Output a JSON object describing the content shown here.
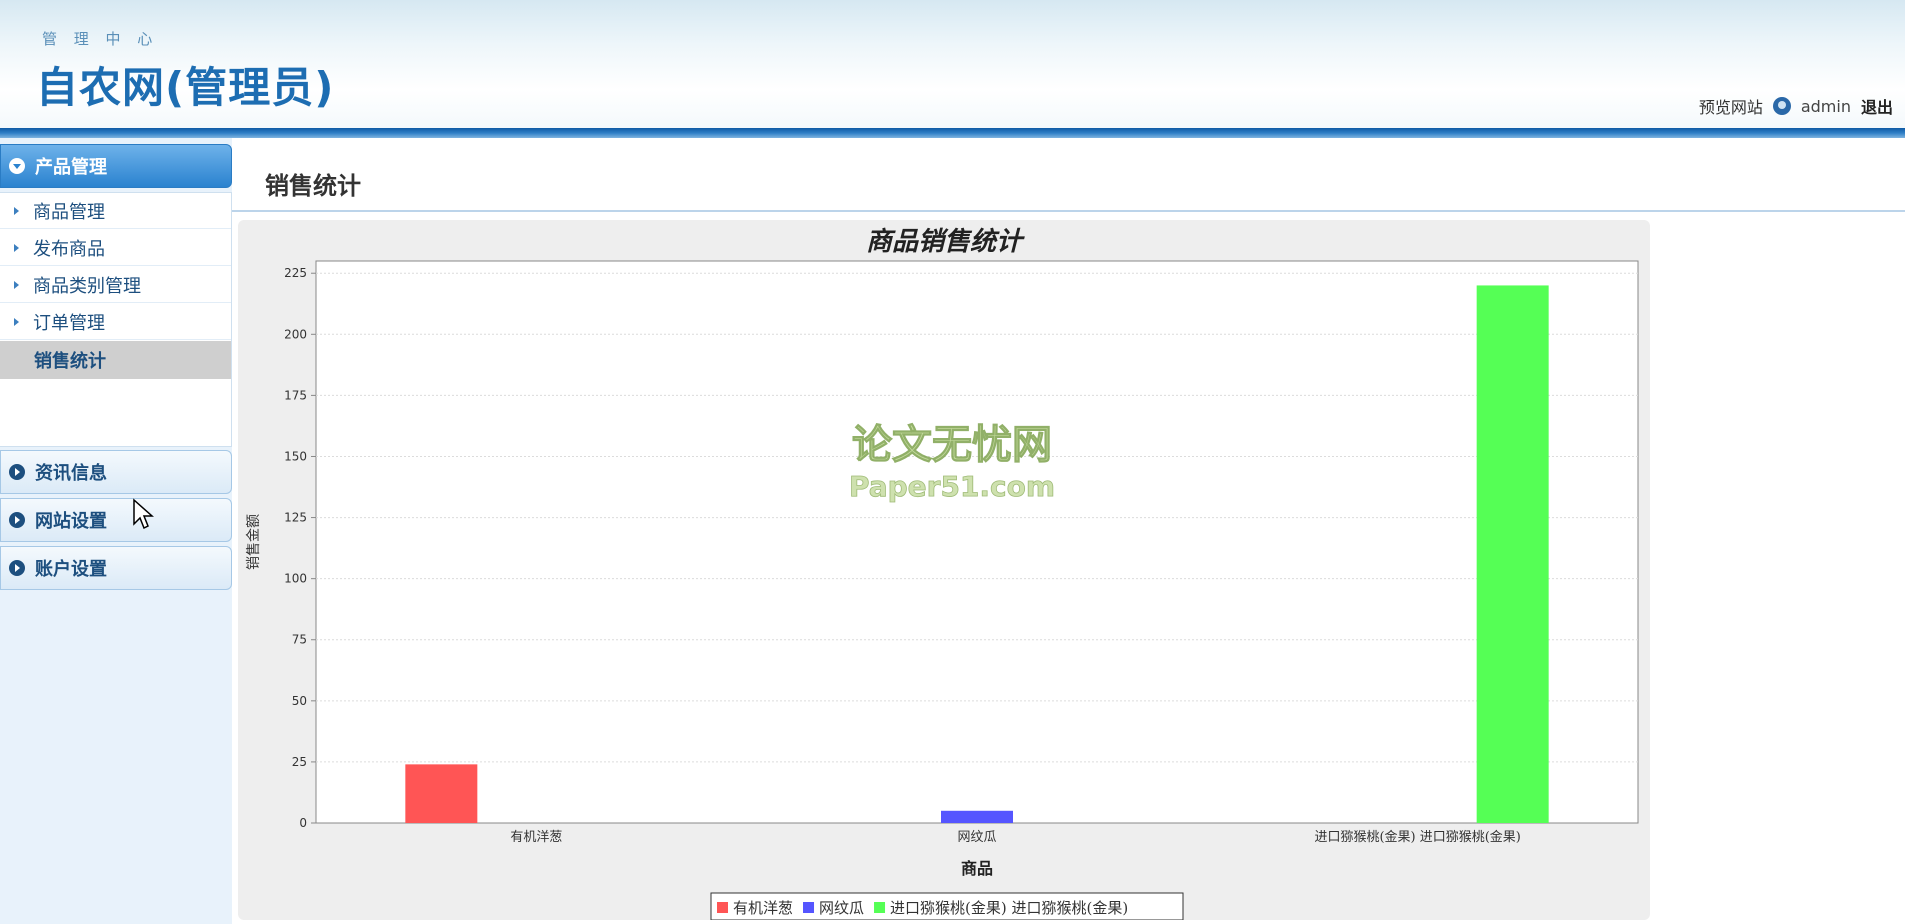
{
  "header": {
    "subtitle": "管 理 中 心",
    "title": "自农网(管理员)",
    "preview_link": "预览网站",
    "username": "admin",
    "logout": "退出"
  },
  "sidebar": {
    "panels": [
      {
        "label": "产品管理",
        "state": "expanded"
      },
      {
        "label": "资讯信息",
        "state": "collapsed"
      },
      {
        "label": "网站设置",
        "state": "collapsed"
      },
      {
        "label": "账户设置",
        "state": "collapsed"
      }
    ],
    "items": [
      {
        "label": "商品管理"
      },
      {
        "label": "发布商品"
      },
      {
        "label": "商品类别管理"
      },
      {
        "label": "订单管理"
      },
      {
        "label": "销售统计",
        "active": true
      }
    ]
  },
  "main": {
    "page_title": "销售统计"
  },
  "watermark": {
    "line1": "论文无忧网",
    "line2": "Paper51.com"
  },
  "chart_data": {
    "type": "bar",
    "title": "商品销售统计",
    "xlabel": "商品",
    "ylabel": "销售金额",
    "categories": [
      "有机洋葱",
      "网纹瓜",
      "进口猕猴桃(金果) 进口猕猴桃(金果)"
    ],
    "values": [
      24,
      5,
      220
    ],
    "colors": [
      "#ff5555",
      "#5555ff",
      "#55ff55"
    ],
    "legend": [
      "有机洋葱",
      "网纹瓜",
      "进口猕猴桃(金果) 进口猕猴桃(金果)"
    ],
    "ylim": [
      0,
      230
    ],
    "yticks": [
      0,
      25,
      50,
      75,
      100,
      125,
      150,
      175,
      200,
      225
    ],
    "grid": true,
    "legend_position": "bottom"
  }
}
